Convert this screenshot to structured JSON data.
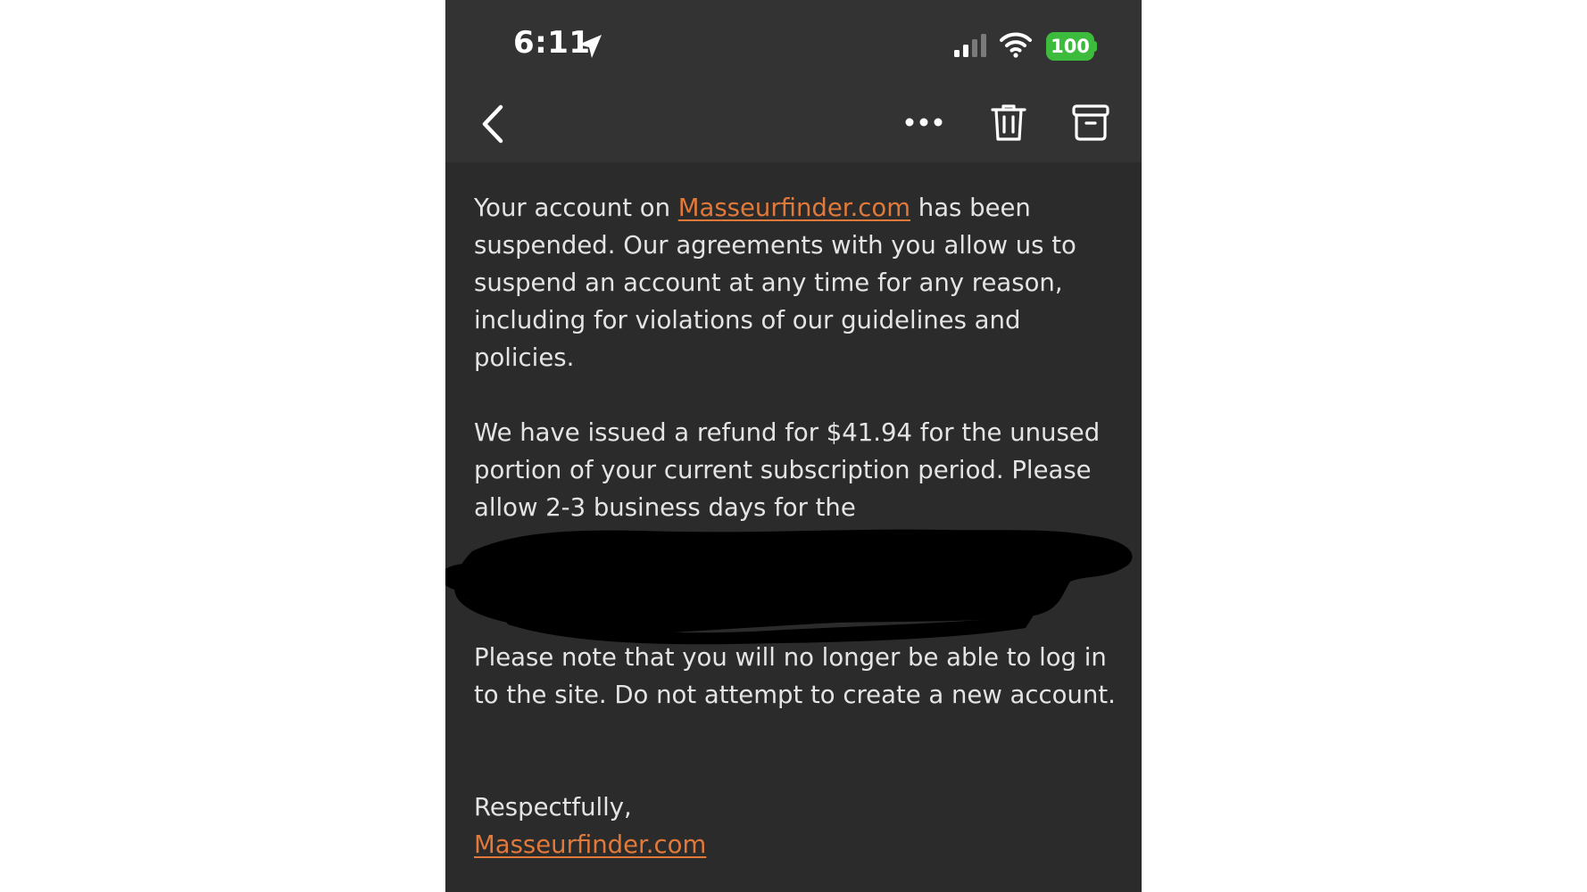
{
  "status_bar": {
    "time": "6:11",
    "battery": "100",
    "icons": [
      "location-arrow-icon",
      "cellular-signal-icon",
      "wifi-icon",
      "battery-icon"
    ]
  },
  "nav_bar": {
    "icons": [
      "chevron-left-icon",
      "more-dots-icon",
      "trash-icon",
      "archive-icon"
    ]
  },
  "email": {
    "p1_before": "Your account on ",
    "p1_link": "Masseurfinder.com",
    "p1_after": " has been suspended. Our agreements with you allow us to suspend an account at any time for any reason, including for violations of our guidelines and policies.",
    "p2": "We have issued a refund for $41.94 for the unused portion of your current subscription period. Please allow 2-3 business days for the",
    "p3": "Please note that you will no longer be able to log in to the site. Do not attempt to create a new account.",
    "closing": "Respectfully,",
    "signature_link": "Masseurfinder.com"
  },
  "colors": {
    "background": "#2b2b2b",
    "header": "#333333",
    "link": "#e0793a",
    "battery": "#3dbb3d",
    "redaction": "#000000"
  }
}
